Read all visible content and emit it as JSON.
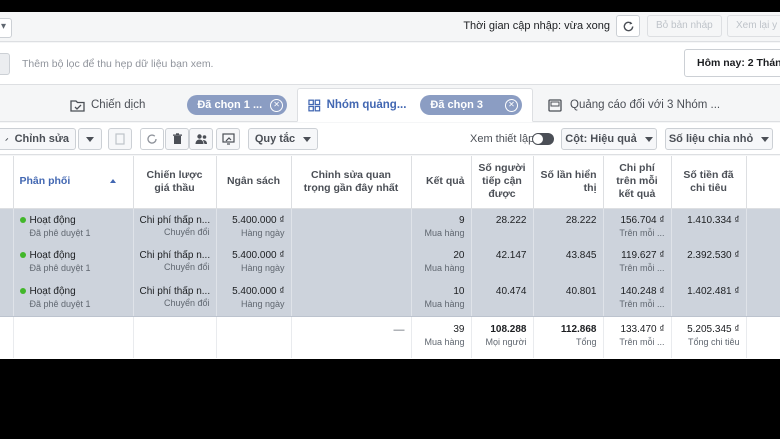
{
  "topbar": {
    "status_text": "Thời gian cập nhập: vừa xong",
    "discard_label": "Bỏ bản nháp",
    "review_label": "Xem lại y"
  },
  "filter": {
    "placeholder": "Thêm bộ lọc để thu hẹp dữ liệu bạn xem.",
    "date_label": "Hôm nay: 2 Tháng"
  },
  "tabs": [
    {
      "label": "Chiến dịch",
      "chip": "Đã chọn 1 ..."
    },
    {
      "label": "Nhóm quảng...",
      "chip": "Đã chọn 3"
    },
    {
      "label": "Quảng cáo đối với 3 Nhóm ..."
    }
  ],
  "toolbar": {
    "edit_label": "Chỉnh sửa",
    "rules_label": "Quy tắc",
    "view_setup_label": "Xem thiết lập",
    "columns_label": "Cột: Hiệu quả",
    "breakdown_label": "Số liệu chia nhỏ"
  },
  "table": {
    "headers": {
      "delivery": "Phân phối",
      "bid_strategy": "Chiến lược giá thầu",
      "budget": "Ngân sách",
      "recent_edits": "Chỉnh sửa quan trọng gần đây nhất",
      "results": "Kết quả",
      "reach": "Số người tiếp cận được",
      "impressions": "Số lần hiển thị",
      "cost_per_result": "Chi phí trên mỗi kết quả",
      "amount_spent": "Số tiền đã chi tiêu"
    },
    "rows": [
      {
        "status": "Hoạt động",
        "status_sub": "Đã phê duyệt 1",
        "bid": "Chi phí thấp n...",
        "bid_sub": "Chuyển đổi",
        "budget": "5.400.000 ₫",
        "budget_sub": "Hàng ngày",
        "results": "9",
        "results_sub": "Mua hàng",
        "reach": "28.222",
        "impressions": "28.222",
        "cpr": "156.704 ₫",
        "cpr_sub": "Trên mỗi ...",
        "spent": "1.410.334 ₫"
      },
      {
        "status": "Hoạt động",
        "status_sub": "Đã phê duyệt 1",
        "bid": "Chi phí thấp n...",
        "bid_sub": "Chuyển đổi",
        "budget": "5.400.000 ₫",
        "budget_sub": "Hàng ngày",
        "results": "20",
        "results_sub": "Mua hàng",
        "reach": "42.147",
        "impressions": "43.845",
        "cpr": "119.627 ₫",
        "cpr_sub": "Trên mỗi ...",
        "spent": "2.392.530 ₫"
      },
      {
        "status": "Hoạt động",
        "status_sub": "Đã phê duyệt 1",
        "bid": "Chi phí thấp n...",
        "bid_sub": "Chuyển đổi",
        "budget": "5.400.000 ₫",
        "budget_sub": "Hàng ngày",
        "results": "10",
        "results_sub": "Mua hàng",
        "reach": "40.474",
        "impressions": "40.801",
        "cpr": "140.248 ₫",
        "cpr_sub": "Trên mỗi ...",
        "spent": "1.402.481 ₫"
      }
    ],
    "total": {
      "recent_edits": "—",
      "results": "39",
      "results_sub": "Mua hàng",
      "reach": "108.288",
      "reach_sub": "Mọi người",
      "impressions": "112.868",
      "impressions_sub": "Tổng",
      "cpr": "133.470 ₫",
      "cpr_sub": "Trên mỗi ...",
      "spent": "5.205.345 ₫",
      "spent_sub": "Tổng chi tiêu"
    }
  }
}
